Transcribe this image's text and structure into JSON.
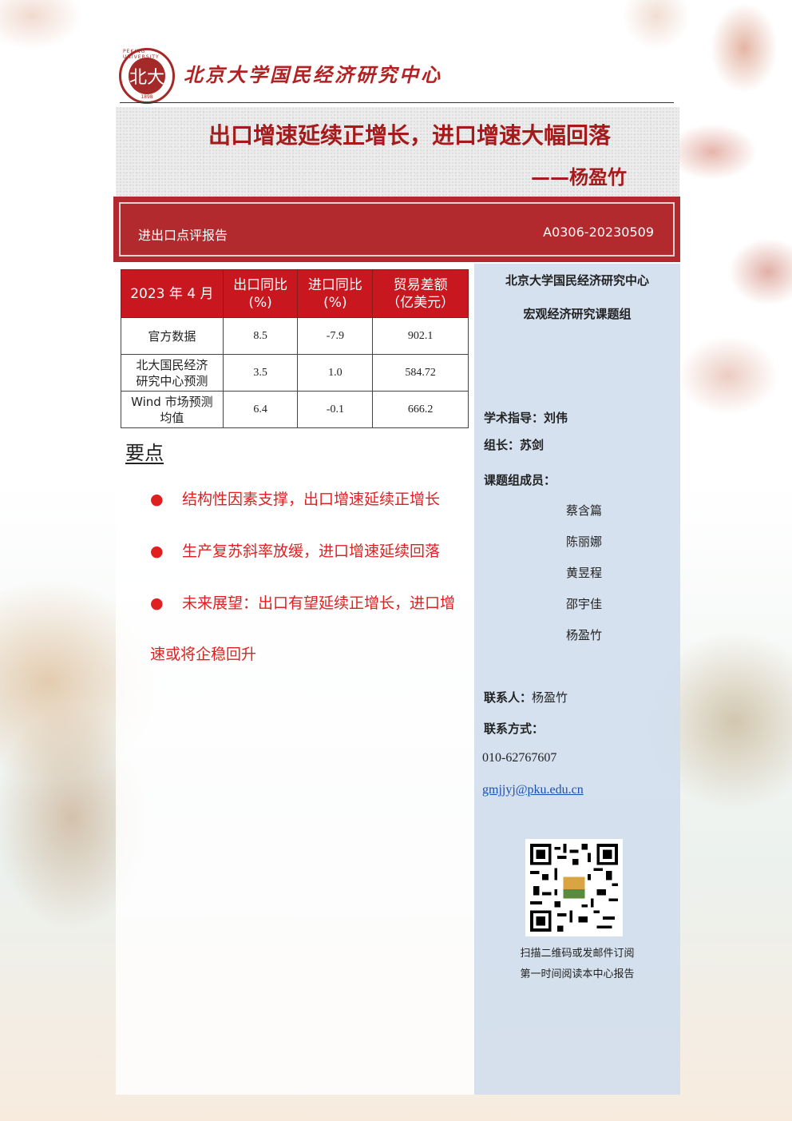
{
  "header": {
    "org_name": "北京大学国民经济研究中心",
    "logo_text": "PEKING UNIVERSITY",
    "logo_year": "1898",
    "logo_glyph": "北大"
  },
  "title": {
    "main": "出口增速延续正增长，进口增速大幅回落",
    "author": "——杨盈竹"
  },
  "banner": {
    "report_type": "进出口点评报告",
    "report_code": "A0306-20230509"
  },
  "table": {
    "headers": [
      "2023 年 4 月",
      "出口同比\n(%)",
      "进口同比\n(%)",
      "贸易差额\n（亿美元）"
    ],
    "rows": [
      [
        "官方数据",
        "8.5",
        "-7.9",
        "902.1"
      ],
      [
        "北大国民经济研究中心预测",
        "3.5",
        "1.0",
        "584.72"
      ],
      [
        "Wind 市场预测均值",
        "6.4",
        "-0.1",
        "666.2"
      ]
    ]
  },
  "key_points": {
    "title": "要点",
    "bullet": "●",
    "items": [
      "结构性因素支撑，出口增速延续正增长",
      "生产复苏斜率放缓，进口增速延续回落",
      "未来展望：出口有望延续正增长，进口增"
    ],
    "item3_cont": "速或将企稳回升"
  },
  "sidebar": {
    "org": "北京大学国民经济研究中心",
    "group": "宏观经济研究课题组",
    "advisor": "学术指导：刘伟",
    "leader": "组长：苏剑",
    "members_label": "课题组成员：",
    "members": [
      "蔡含篇",
      "陈丽娜",
      "黄昱程",
      "邵宇佳",
      "杨盈竹"
    ],
    "contact_label": "联系人：",
    "contact_name": "杨盈竹",
    "method_label": "联系方式：",
    "phone": "010-62767607",
    "email": "gmjjyj@pku.edu.cn",
    "caption1": "扫描二维码或发邮件订阅",
    "caption2": "第一时间阅读本中心报告"
  },
  "colors": {
    "brand_red": "#b22a2e",
    "title_red": "#a51b1b",
    "table_header": "#c8171f",
    "sidebar_bg": "#d2deee",
    "bullet_red": "#e02020"
  }
}
